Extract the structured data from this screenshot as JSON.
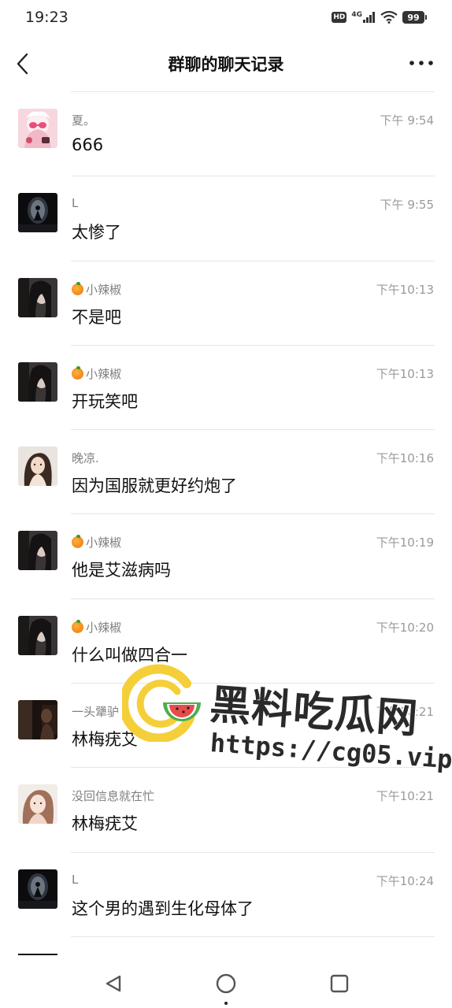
{
  "status_bar": {
    "time": "19:23",
    "hd": "HD",
    "network": "4G",
    "battery": "99"
  },
  "nav": {
    "title": "群聊的聊天记录",
    "back_icon": "chevron-left-icon",
    "more_icon": "more-dots-icon"
  },
  "messages": [
    {
      "sender": "夏。",
      "time": "下午 9:54",
      "text": "666",
      "has_icon": false
    },
    {
      "sender": "L",
      "time": "下午 9:55",
      "text": "太惨了",
      "has_icon": false
    },
    {
      "sender": "小辣椒",
      "time": "下午10:13",
      "text": "不是吧",
      "has_icon": true
    },
    {
      "sender": "小辣椒",
      "time": "下午10:13",
      "text": "开玩笑吧",
      "has_icon": true
    },
    {
      "sender": "晚凉.",
      "time": "下午10:16",
      "text": "因为国服就更好约炮了",
      "has_icon": false
    },
    {
      "sender": "小辣椒",
      "time": "下午10:19",
      "text": "他是艾滋病吗",
      "has_icon": true
    },
    {
      "sender": "小辣椒",
      "time": "下午10:20",
      "text": "什么叫做四合一",
      "has_icon": true
    },
    {
      "sender": "一头犟驴",
      "time": "下午10:21",
      "text": "林梅疣艾",
      "has_icon": false
    },
    {
      "sender": "没回信息就在忙",
      "time": "下午10:21",
      "text": "林梅疣艾",
      "has_icon": false
    },
    {
      "sender": "L",
      "time": "下午10:24",
      "text": "这个男的遇到生化母体了",
      "has_icon": false
    }
  ],
  "watermark": {
    "title": "黑料吃瓜网",
    "url": "https://cg05.vip"
  },
  "bottom_nav": {
    "back_icon": "triangle-back-icon",
    "home_icon": "circle-home-icon",
    "recent_icon": "square-recent-icon"
  },
  "colors": {
    "accent_logo_yellow": "#f5cf3a",
    "watermelon_green": "#4caf50",
    "watermelon_red": "#e84b4b"
  }
}
